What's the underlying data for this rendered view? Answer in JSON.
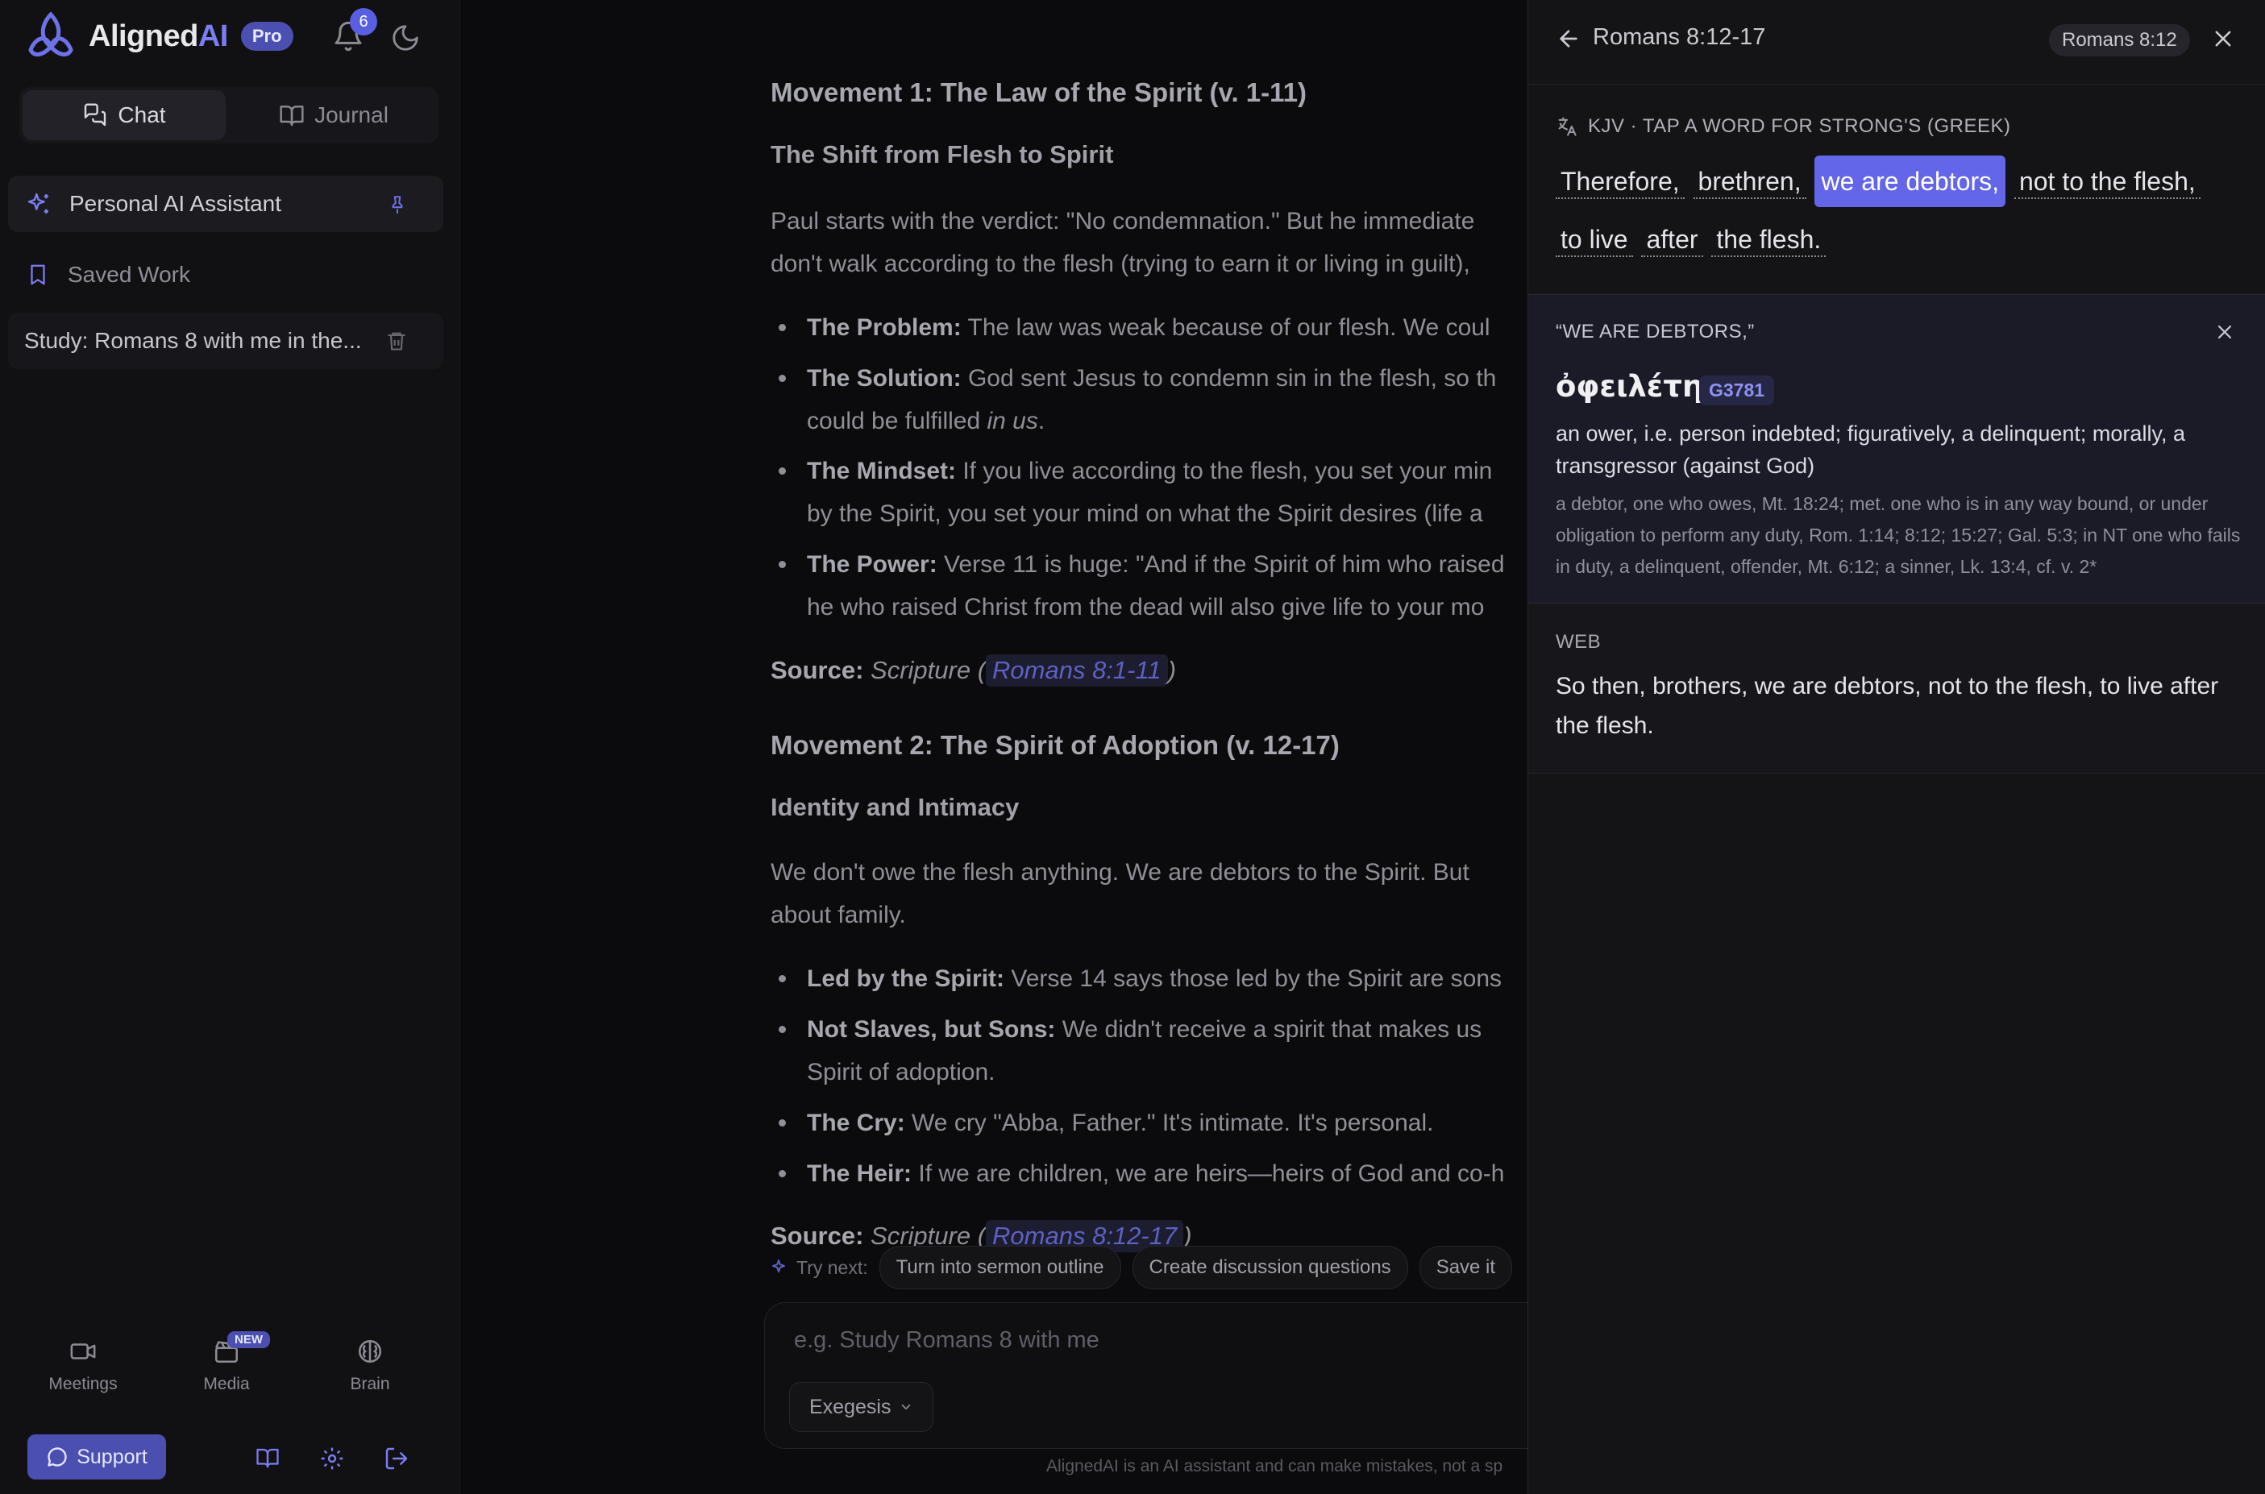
{
  "app": {
    "name_primary": "Aligned",
    "name_accent": "AI",
    "plan_badge": "Pro",
    "notification_count": "6",
    "colors": {
      "accent": "#6366e8",
      "badge": "#4b4fb0",
      "background": "#0b0b0e",
      "panel": "#141417"
    }
  },
  "sidebar": {
    "tabs": [
      {
        "label": "Chat",
        "active": true
      },
      {
        "label": "Journal",
        "active": false
      }
    ],
    "pinned_label": "Personal AI Assistant",
    "saved_label": "Saved Work",
    "conversation_title": "Study: Romans 8 with me in the...",
    "bottom_nav": [
      {
        "label": "Meetings",
        "icon": "video-icon"
      },
      {
        "label": "Media",
        "icon": "clapperboard-icon",
        "badge": "NEW"
      },
      {
        "label": "Brain",
        "icon": "brain-icon"
      }
    ],
    "support_label": "Support"
  },
  "chat": {
    "movement1_heading": "Movement 1: The Law of the Spirit (v. 1-11)",
    "m1_subheading": "The Shift from Flesh to Spirit",
    "m1_para_line1": "Paul starts with the verdict: \"No condemnation.\" But he immediate",
    "m1_para_line2": "don't walk according to the flesh (trying to earn it or living in guilt),",
    "m1_bullets": [
      {
        "bold": "The Problem:",
        "text": " The law was weak because of our flesh. We coul"
      },
      {
        "bold": "The Solution:",
        "text": " God sent Jesus to condemn sin in the flesh, so th",
        "line2": "could be fulfilled ",
        "line2_em": "in us",
        "line2_end": "."
      },
      {
        "bold": "The Mindset:",
        "text": " If you live according to the flesh, you set your min",
        "line2": "by the Spirit, you set your mind on what the Spirit desires (life a"
      },
      {
        "bold": "The Power:",
        "text": " Verse 11 is huge: \"And if the Spirit of him who raised",
        "line2": "he who raised Christ from the dead will also give life to your mo"
      }
    ],
    "source_label": "Source:",
    "source_scripture": "Scripture (",
    "source_close": ")",
    "source1_ref": "Romans 8:1-11",
    "movement2_heading": "Movement 2: The Spirit of Adoption (v. 12-17)",
    "m2_subheading": "Identity and Intimacy",
    "m2_para_line1": "We don't owe the flesh anything. We are debtors to the Spirit. But",
    "m2_para_line2": "about family.",
    "m2_bullets": [
      {
        "bold": "Led by the Spirit:",
        "text": " Verse 14 says those led by the Spirit are sons"
      },
      {
        "bold": "Not Slaves, but Sons:",
        "text": " We didn't receive a spirit that makes us",
        "line2": "Spirit of adoption."
      },
      {
        "bold": "The Cry:",
        "text": " We cry \"Abba, Father.\" It's intimate. It's personal."
      },
      {
        "bold": "The Heir:",
        "text": " If we are children, we are heirs—heirs of God and co-h"
      }
    ],
    "source2_ref": "Romans 8:12-17",
    "try_next_label": "Try next:",
    "suggestions": [
      "Turn into sermon outline",
      "Create discussion questions",
      "Save it"
    ],
    "input_placeholder": "e.g. Study Romans 8 with me",
    "mode_label": "Exegesis",
    "disclaimer": "AlignedAI is an AI assistant and can make mistakes, not a sp"
  },
  "panel": {
    "title": "Romans 8:12-17",
    "chapter_badge": "Romans 8:12",
    "kjv_label": "KJV · TAP A WORD FOR STRONG'S (GREEK)",
    "kjv_words": [
      "Therefore,",
      "brethren,",
      "we are debtors,",
      "not to the flesh,",
      "to live",
      "after",
      "the flesh."
    ],
    "selected_word_index": 2,
    "strongs": {
      "heading": "“WE ARE DEBTORS,”",
      "greek": "ὀφειλέτης",
      "number": "G3781",
      "definition": "an ower, i.e. person indebted; figuratively, a delinquent; morally, a transgressor (against God)",
      "detail": "a debtor, one who owes, Mt. 18:24; met. one who is in any way bound, or under obligation to perform any duty, Rom. 1:14; 8:12; 15:27; Gal. 5:3; in NT one who fails in duty, a delinquent, offender, Mt. 6:12; a sinner, Lk. 13:4, cf. v. 2*"
    },
    "web_label": "WEB",
    "web_text": "So then, brothers, we are debtors, not to the flesh, to live after the flesh."
  }
}
